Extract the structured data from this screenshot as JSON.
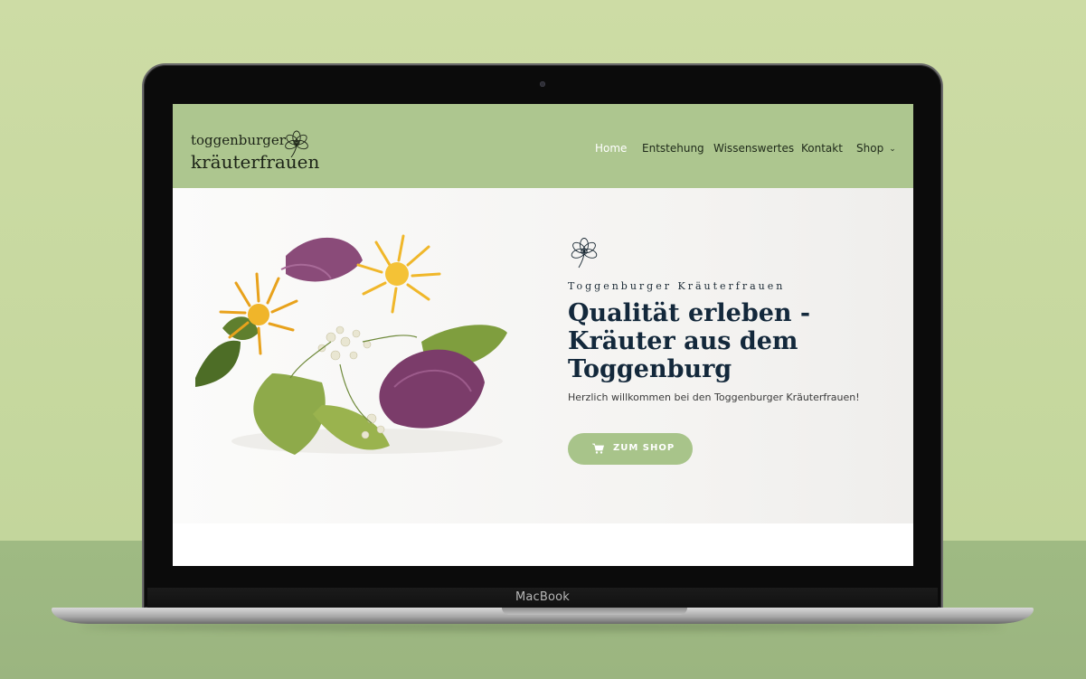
{
  "device": {
    "label": "MacBook"
  },
  "site": {
    "logo": {
      "line1": "toggenburger",
      "line2": "kräuterfrauen",
      "icon": "flower-icon"
    },
    "nav": {
      "items": [
        {
          "label": "Home",
          "active": true
        },
        {
          "label": "Entstehung"
        },
        {
          "label": "Wissenswertes"
        },
        {
          "label": "Kontakt"
        },
        {
          "label": "Shop",
          "has_dropdown": true,
          "icon": "chevron-down-icon"
        }
      ]
    },
    "hero": {
      "eyebrow": "Toggenburger Kräuterfrauen",
      "title": "Qualität erleben - Kräuter aus dem Toggenburg",
      "subtitle": "Herzlich willkommen bei den Toggenburger Kräuterfrauen!",
      "button": {
        "label": "ZUM SHOP",
        "icon": "cart-icon"
      },
      "image": "dried-herbs-and-flowers"
    }
  },
  "colors": {
    "background": "#c8da9f",
    "header_green": "#adc68f",
    "button_green": "#a8c48a",
    "title_navy": "#13283b"
  }
}
